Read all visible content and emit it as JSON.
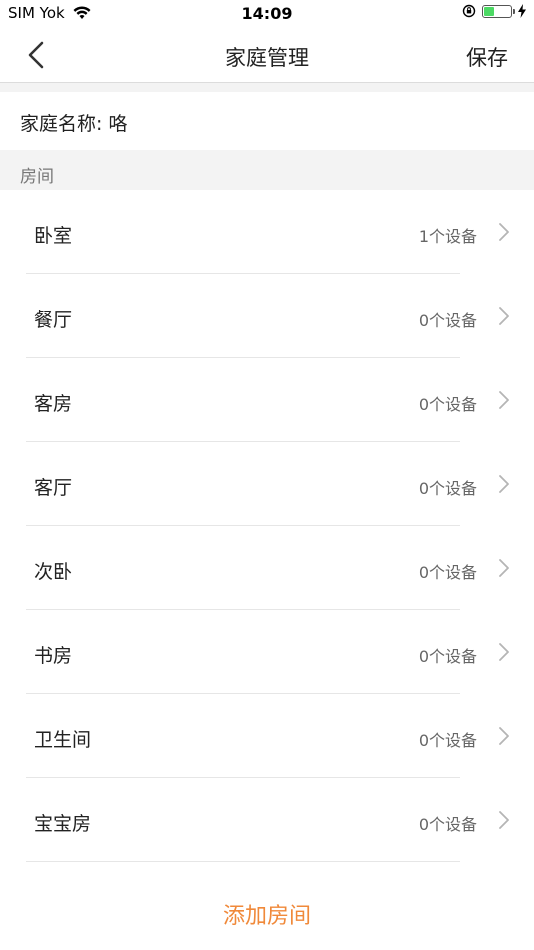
{
  "status_bar": {
    "carrier": "SIM Yok",
    "time": "14:09",
    "battery_level": 0.4
  },
  "nav": {
    "title": "家庭管理",
    "save_label": "保存",
    "back_icon": "chevron-left-icon"
  },
  "family": {
    "label": "家庭名称: 咯"
  },
  "rooms_section": {
    "header": "房间",
    "items": [
      {
        "name": "卧室",
        "devices": "1个设备"
      },
      {
        "name": "餐厅",
        "devices": "0个设备"
      },
      {
        "name": "客房",
        "devices": "0个设备"
      },
      {
        "name": "客厅",
        "devices": "0个设备"
      },
      {
        "name": "次卧",
        "devices": "0个设备"
      },
      {
        "name": "书房",
        "devices": "0个设备"
      },
      {
        "name": "卫生间",
        "devices": "0个设备"
      },
      {
        "name": "宝宝房",
        "devices": "0个设备"
      }
    ]
  },
  "add_room_label": "添加房间",
  "colors": {
    "accent": "#f0893a",
    "section_bg": "#f3f3f3",
    "battery_green": "#4cd964"
  }
}
